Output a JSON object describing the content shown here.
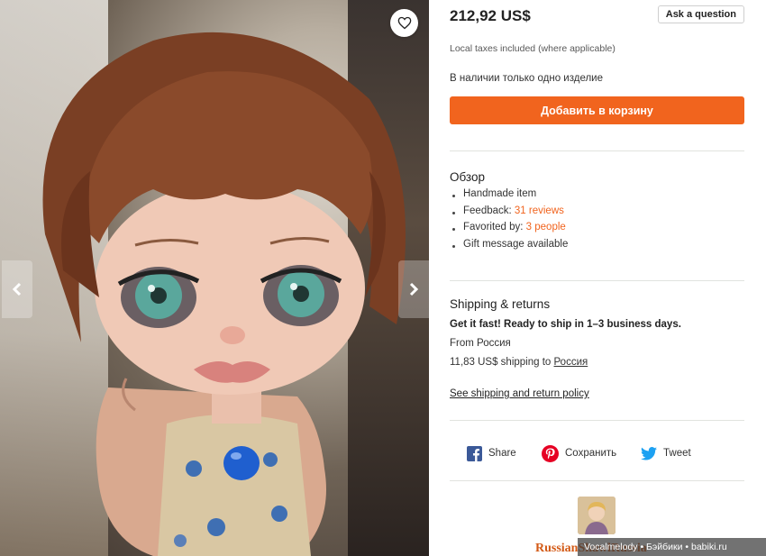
{
  "listing": {
    "price": "212,92 US$",
    "ask_question_label": "Ask a question",
    "taxes_note": "Local taxes included (where applicable)",
    "stock_note": "В наличии только одно изделие",
    "add_to_cart_label": "Добавить в корзину"
  },
  "overview": {
    "title": "Обзор",
    "items": [
      {
        "text": "Handmade item",
        "link": ""
      },
      {
        "text": "Feedback: ",
        "link": "31 reviews"
      },
      {
        "text": "Favorited by: ",
        "link": "3 people"
      },
      {
        "text": "Gift message available",
        "link": ""
      }
    ]
  },
  "shipping": {
    "title": "Shipping & returns",
    "fast_note": "Get it fast! Ready to ship in 1–3 business days.",
    "from": "From Россия",
    "cost_prefix": "11,83 US$ shipping to ",
    "cost_destination": "Россия",
    "policy_link": "See shipping and return policy"
  },
  "share": {
    "facebook_label": "Share",
    "pinterest_label": "Сохранить",
    "twitter_label": "Tweet"
  },
  "shop": {
    "name": "RussianShawlRussia"
  },
  "watermark": "Vocalmelody • Бэйбики • babiki.ru",
  "icons": {
    "favorite": "heart-icon",
    "prev": "chevron-left-icon",
    "next": "chevron-right-icon",
    "facebook": "facebook-icon",
    "pinterest": "pinterest-icon",
    "twitter": "twitter-icon"
  },
  "colors": {
    "accent": "#f1641e",
    "facebook": "#3b5998",
    "pinterest": "#e60023",
    "twitter": "#1da1f2"
  }
}
